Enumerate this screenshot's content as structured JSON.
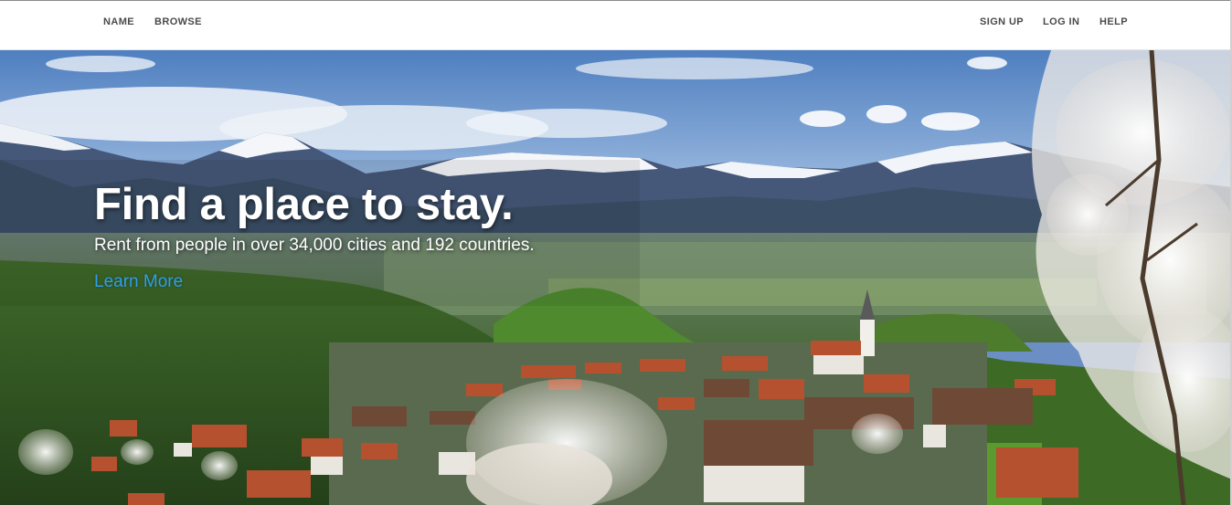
{
  "navbar": {
    "left_items": [
      {
        "label": "NAME"
      },
      {
        "label": "BROWSE"
      }
    ],
    "right_items": [
      {
        "label": "SIGN UP"
      },
      {
        "label": "LOG IN"
      },
      {
        "label": "HELP"
      }
    ]
  },
  "hero": {
    "title": "Find a place to stay.",
    "subtitle": "Rent from people in over 34,000 cities and 192 countries.",
    "link_label": "Learn More"
  },
  "colors": {
    "link": "#2f9fe8",
    "nav_text": "#4a4a4a",
    "hero_text": "#ffffff"
  }
}
